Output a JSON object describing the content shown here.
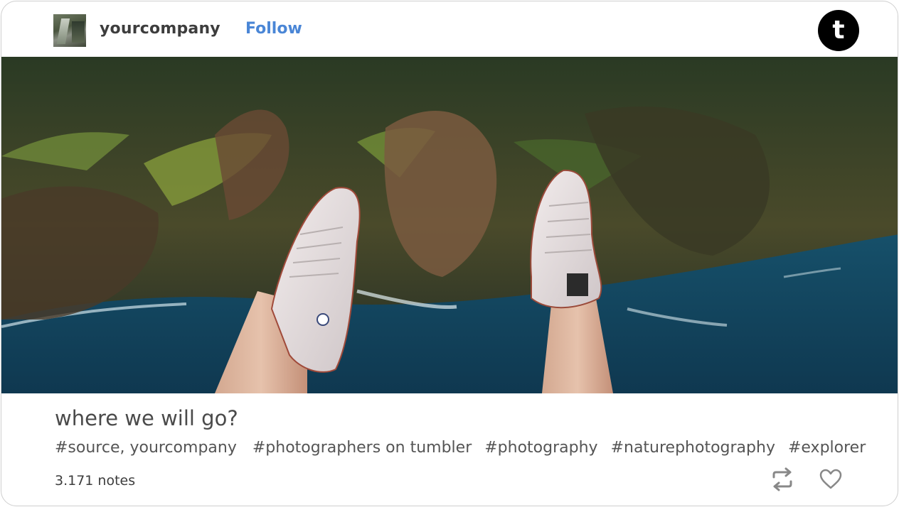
{
  "post": {
    "author": "yourcompany",
    "follow_label": "Follow",
    "brand_letter": "t",
    "title": "where we will go?",
    "tags": [
      "#source, yourcompany",
      "#photographers on tumbler",
      "#photography",
      "#naturephotography",
      "#explorer"
    ],
    "notes": "3.171  notes"
  },
  "icons": {
    "avatar": "avatar-image",
    "brand": "tumblr-logo-icon",
    "reblog": "reblog-icon",
    "like": "heart-icon"
  },
  "colors": {
    "follow": "#4a86d6",
    "text": "#4a4a4a",
    "icon": "#888888"
  }
}
